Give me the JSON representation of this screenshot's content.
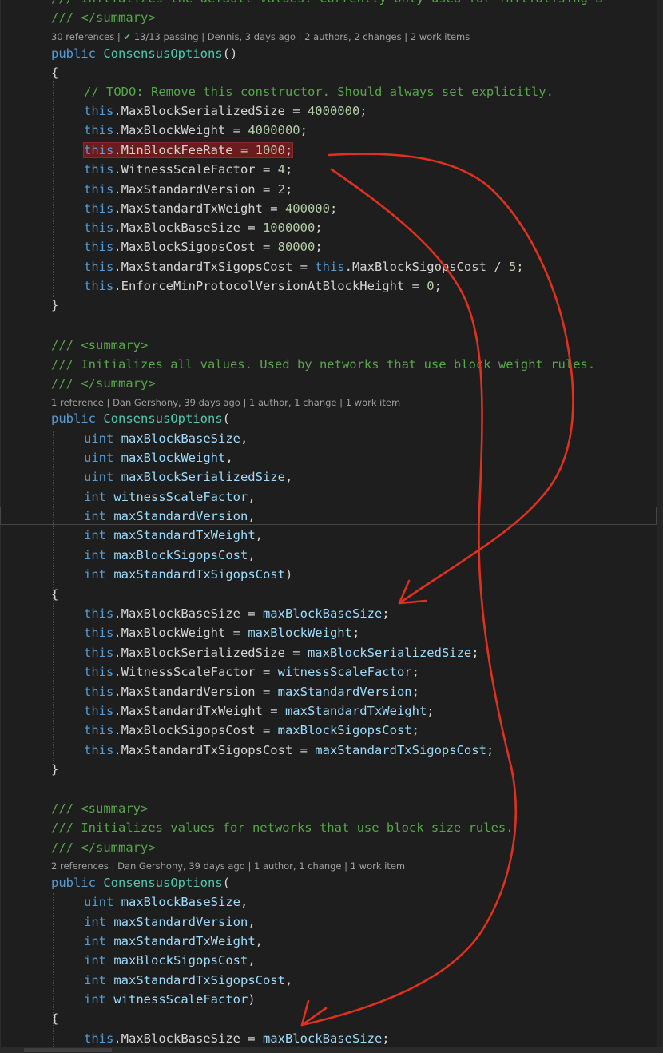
{
  "lines": {
    "l0": "/// Initializes the default values. Currently only used for initialising B",
    "l1": "/// </summary>",
    "lens1": {
      "refs": "30 references",
      "check": "✔",
      "passing": "13/13 passing",
      "author": "Dennis, 3 days ago",
      "authors": "2 authors, 2 changes",
      "items": "2 work items"
    },
    "l2": {
      "kw": "public",
      "type": "ConsensusOptions",
      "rest": "()"
    },
    "l3": "{",
    "l4": "// TODO: Remove this constructor. Should always set explicitly.",
    "l5": {
      "this": "this",
      "a": ".MaxBlockSerializedSize = ",
      "num": "4000000",
      "end": ";"
    },
    "l6": {
      "this": "this",
      "a": ".MaxBlockWeight = ",
      "num": "4000000",
      "end": ";"
    },
    "l7": {
      "this": "this",
      "a": ".MinBlockFeeRate = ",
      "num": "1000",
      "end": ";"
    },
    "l8": {
      "this": "this",
      "a": ".WitnessScaleFactor = ",
      "num": "4",
      "end": ";"
    },
    "l9": {
      "this": "this",
      "a": ".MaxStandardVersion = ",
      "num": "2",
      "end": ";"
    },
    "l10": {
      "this": "this",
      "a": ".MaxStandardTxWeight = ",
      "num": "400000",
      "end": ";"
    },
    "l11": {
      "this": "this",
      "a": ".MaxBlockBaseSize = ",
      "num": "1000000",
      "end": ";"
    },
    "l12": {
      "this": "this",
      "a": ".MaxBlockSigopsCost = ",
      "num": "80000",
      "end": ";"
    },
    "l13": {
      "this": "this",
      "a": ".MaxStandardTxSigopsCost = ",
      "this2": "this",
      "b": ".MaxBlockSigopsCost / ",
      "num": "5",
      "end": ";"
    },
    "l14": {
      "this": "this",
      "a": ".EnforceMinProtocolVersionAtBlockHeight = ",
      "num": "0",
      "end": ";"
    },
    "l15": "}",
    "l16": "/// <summary>",
    "l17": "/// Initializes all values. Used by networks that use block weight rules.",
    "l18": "/// </summary>",
    "lens2": {
      "refs": "1 reference",
      "author": "Dan Gershony, 39 days ago",
      "authors": "1 author, 1 change",
      "items": "1 work item"
    },
    "l19": {
      "kw": "public",
      "type": "ConsensusOptions",
      "rest": "("
    },
    "l20": {
      "kw": "uint",
      "param": "maxBlockBaseSize",
      "end": ","
    },
    "l21": {
      "kw": "uint",
      "param": "maxBlockWeight",
      "end": ","
    },
    "l22": {
      "kw": "uint",
      "param": "maxBlockSerializedSize",
      "end": ","
    },
    "l23": {
      "kw": "int",
      "param": "witnessScaleFactor",
      "end": ","
    },
    "l24": {
      "kw": "int",
      "param": "maxStandardVersion",
      "end": ","
    },
    "l25": {
      "kw": "int",
      "param": "maxStandardTxWeight",
      "end": ","
    },
    "l26": {
      "kw": "int",
      "param": "maxBlockSigopsCost",
      "end": ","
    },
    "l27": {
      "kw": "int",
      "param": "maxStandardTxSigopsCost",
      "end": ")"
    },
    "l28": "{",
    "l29": {
      "this": "this",
      "a": ".MaxBlockBaseSize = ",
      "param": "maxBlockBaseSize",
      "end": ";"
    },
    "l30": {
      "this": "this",
      "a": ".MaxBlockWeight = ",
      "param": "maxBlockWeight",
      "end": ";"
    },
    "l31": {
      "this": "this",
      "a": ".MaxBlockSerializedSize = ",
      "param": "maxBlockSerializedSize",
      "end": ";"
    },
    "l32": {
      "this": "this",
      "a": ".WitnessScaleFactor = ",
      "param": "witnessScaleFactor",
      "end": ";"
    },
    "l33": {
      "this": "this",
      "a": ".MaxStandardVersion = ",
      "param": "maxStandardVersion",
      "end": ";"
    },
    "l34": {
      "this": "this",
      "a": ".MaxStandardTxWeight = ",
      "param": "maxStandardTxWeight",
      "end": ";"
    },
    "l35": {
      "this": "this",
      "a": ".MaxBlockSigopsCost = ",
      "param": "maxBlockSigopsCost",
      "end": ";"
    },
    "l36": {
      "this": "this",
      "a": ".MaxStandardTxSigopsCost = ",
      "param": "maxStandardTxSigopsCost",
      "end": ";"
    },
    "l37": "}",
    "l38": "/// <summary>",
    "l39": "/// Initializes values for networks that use block size rules.",
    "l40": "/// </summary>",
    "lens3": {
      "refs": "2 references",
      "author": "Dan Gershony, 39 days ago",
      "authors": "1 author, 1 change",
      "items": "1 work item"
    },
    "l41": {
      "kw": "public",
      "type": "ConsensusOptions",
      "rest": "("
    },
    "l42": {
      "kw": "uint",
      "param": "maxBlockBaseSize",
      "end": ","
    },
    "l43": {
      "kw": "int",
      "param": "maxStandardVersion",
      "end": ","
    },
    "l44": {
      "kw": "int",
      "param": "maxStandardTxWeight",
      "end": ","
    },
    "l45": {
      "kw": "int",
      "param": "maxBlockSigopsCost",
      "end": ","
    },
    "l46": {
      "kw": "int",
      "param": "maxStandardTxSigopsCost",
      "end": ","
    },
    "l47": {
      "kw": "int",
      "param": "witnessScaleFactor",
      "end": ")"
    },
    "l48": "{",
    "l49": {
      "this": "this",
      "a": ".MaxBlockBaseSize = ",
      "param": "maxBlockBaseSize",
      "end": ";"
    },
    "lens_sep": "|"
  },
  "colors": {
    "background": "#1e1e1e",
    "comment": "#57a64a",
    "keyword": "#569cd6",
    "type": "#4ec9b0",
    "number": "#b5cea8",
    "parameter": "#9cdcfe",
    "highlight": "#6b1d1d",
    "annotation": "#e0301e"
  }
}
